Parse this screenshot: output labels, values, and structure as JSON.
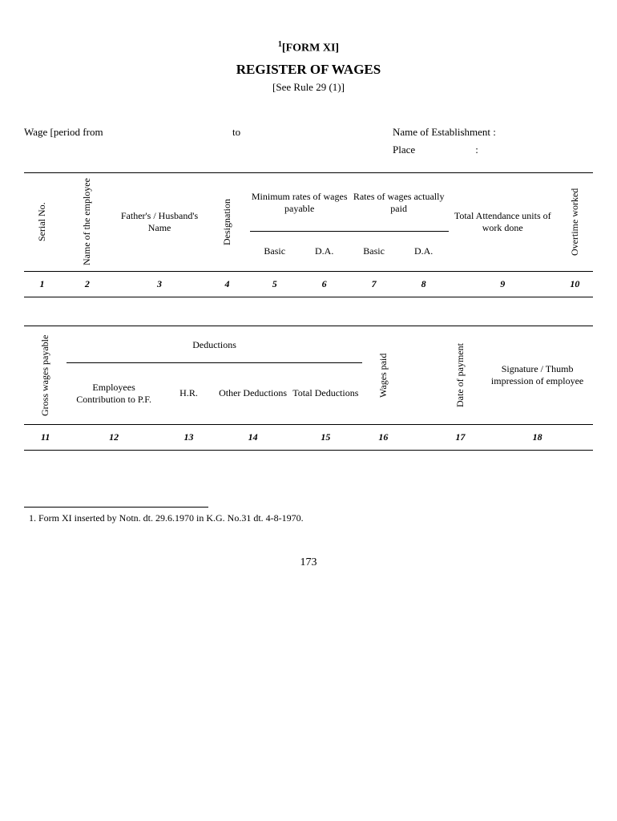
{
  "header": {
    "form_sup": "1",
    "form_label": "[FORM XI]",
    "title": "REGISTER OF WAGES",
    "subtitle": "[See Rule 29 (1)]"
  },
  "meta": {
    "wage_period_from": "Wage [period from",
    "to": "to",
    "name_of_establishment": "Name of Establishment :",
    "place": "Place",
    "colon": ":"
  },
  "table1": {
    "serial_no": "Serial No.",
    "name_of_employee": "Name of the employee",
    "fathers_husbands_name": "Father's / Husband's Name",
    "designation": "Designation",
    "min_rates_group": "Minimum rates of wages payable",
    "rates_actually_group": "Rates of wages actually paid",
    "basic1": "Basic",
    "da1": "D.A.",
    "basic2": "Basic",
    "da2": "D.A.",
    "total_attendance": "Total Attendance units of work done",
    "overtime_worked": "Overtime worked",
    "nums": [
      "1",
      "2",
      "3",
      "4",
      "5",
      "6",
      "7",
      "8",
      "9",
      "10"
    ]
  },
  "table2": {
    "gross_wages_payable": "Gross wages payable",
    "deductions_group": "Deductions",
    "emp_contrib_pf": "Employees Contribution to P.F.",
    "hr": "H.R.",
    "other_deductions": "Other Deductions",
    "total_deductions": "Total Deductions",
    "wages_paid": "Wages paid",
    "date_of_payment": "Date of payment",
    "signature_thumb": "Signature / Thumb impression of employee",
    "nums": [
      "11",
      "12",
      "13",
      "14",
      "15",
      "16",
      "",
      "17",
      "18"
    ]
  },
  "footnote": "1.  Form XI inserted by Notn. dt. 29.6.1970 in K.G. No.31 dt. 4-8-1970.",
  "page_number": "173"
}
